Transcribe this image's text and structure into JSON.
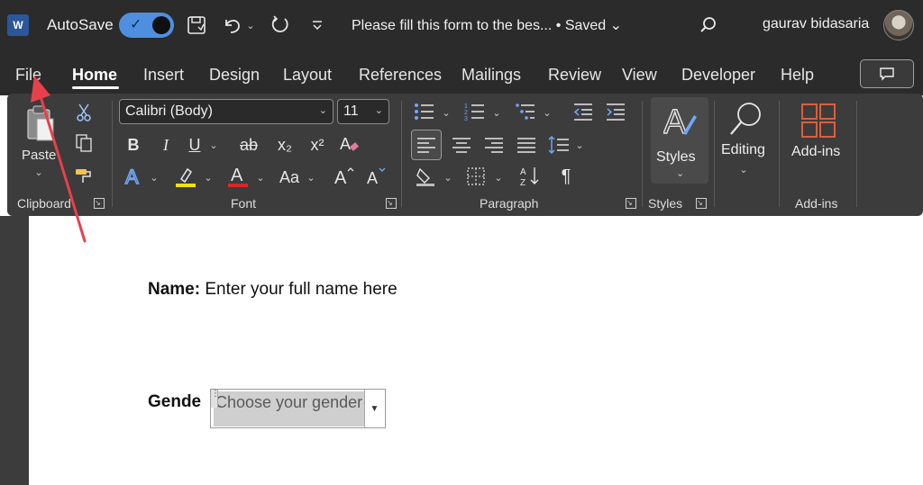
{
  "titlebar": {
    "app_icon": "W",
    "autosave_label": "AutoSave",
    "autosave_on": true,
    "doc_title": "Please fill this form to the bes... • Saved ⌄",
    "user_name": "gaurav bidasaria",
    "icons": [
      "word-icon",
      "save-icon",
      "undo-icon",
      "redo-icon",
      "customize-quick-access-icon",
      "search-icon"
    ]
  },
  "tabs": [
    {
      "label": "File"
    },
    {
      "label": "Home",
      "active": true
    },
    {
      "label": "Insert"
    },
    {
      "label": "Design"
    },
    {
      "label": "Layout"
    },
    {
      "label": "References"
    },
    {
      "label": "Mailings"
    },
    {
      "label": "Review"
    },
    {
      "label": "View"
    },
    {
      "label": "Developer"
    },
    {
      "label": "Help"
    }
  ],
  "ribbon": {
    "clipboard": {
      "label": "Clipboard",
      "paste_label": "Paste"
    },
    "font": {
      "label": "Font",
      "font_name": "Calibri (Body)",
      "font_size": "11",
      "bold": "B",
      "italic": "I",
      "underline": "U",
      "strike": "ab",
      "subscript": "x₂",
      "superscript": "x²",
      "change_case": "Aa"
    },
    "paragraph": {
      "label": "Paragraph"
    },
    "styles": {
      "label": "Styles",
      "button_label": "Styles"
    },
    "editing": {
      "button_label": "Editing"
    },
    "addins": {
      "label": "Add-ins",
      "button_label": "Add-ins"
    },
    "accent_highlight": "#f3e10a",
    "accent_font_color": "#d62828"
  },
  "document": {
    "name_label": "Name:",
    "name_value": "Enter your full name here",
    "gender_label": "Gende",
    "gender_placeholder": "Choose your gender"
  },
  "annotation_color": "#e8404a"
}
